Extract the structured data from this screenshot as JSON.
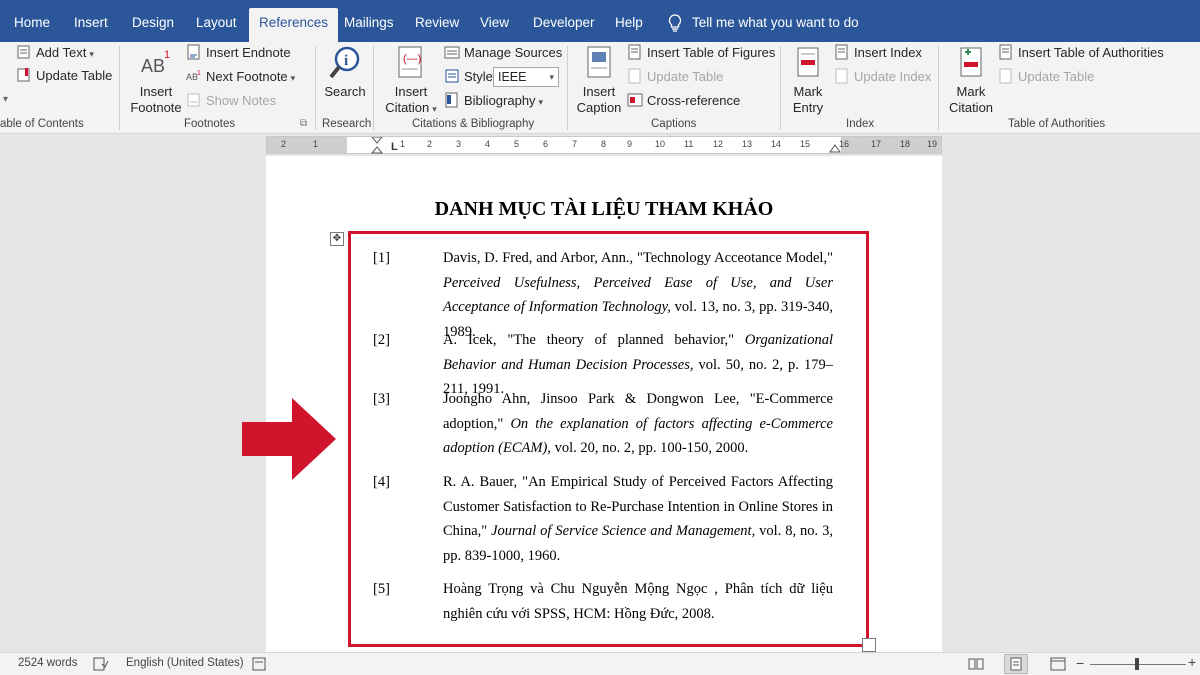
{
  "tabs": [
    {
      "label": "Home",
      "active": false
    },
    {
      "label": "Insert",
      "active": false
    },
    {
      "label": "Design",
      "active": false
    },
    {
      "label": "Layout",
      "active": false
    },
    {
      "label": "References",
      "active": true
    },
    {
      "label": "Mailings",
      "active": false
    },
    {
      "label": "Review",
      "active": false
    },
    {
      "label": "View",
      "active": false
    },
    {
      "label": "Developer",
      "active": false
    },
    {
      "label": "Help",
      "active": false
    }
  ],
  "tell_me": "Tell me what you want to do",
  "ribbon": {
    "toc": {
      "add_text": "Add Text",
      "update_table": "Update Table",
      "group": "able of Contents"
    },
    "footnotes": {
      "insert_footnote": "Insert Footnote",
      "insert_endnote": "Insert Endnote",
      "next_footnote": "Next Footnote",
      "show_notes": "Show Notes",
      "group": "Footnotes"
    },
    "research": {
      "search": "Search",
      "group": "Research"
    },
    "citations": {
      "insert_citation": "Insert Citation",
      "manage_sources": "Manage Sources",
      "style_label": "Style:",
      "style_value": "IEEE",
      "bibliography": "Bibliography",
      "group": "Citations & Bibliography"
    },
    "captions": {
      "insert_caption": "Insert Caption",
      "insert_table_of_figures": "Insert Table of Figures",
      "update_table": "Update Table",
      "cross_reference": "Cross-reference",
      "group": "Captions"
    },
    "index": {
      "mark_entry": "Mark Entry",
      "insert_index": "Insert Index",
      "update_index": "Update Index",
      "group": "Index"
    },
    "authorities": {
      "mark_citation": "Mark Citation",
      "insert_table": "Insert Table of Authorities",
      "update_table": "Update Table",
      "group": "Table of Authorities"
    }
  },
  "ruler_ticks": [
    "2",
    "1",
    "1",
    "2",
    "3",
    "4",
    "5",
    "6",
    "7",
    "8",
    "9",
    "10",
    "11",
    "12",
    "13",
    "14",
    "15",
    "16",
    "17",
    "18",
    "19"
  ],
  "document": {
    "title": "DANH MỤC TÀI LIỆU THAM KHẢO",
    "references": [
      {
        "num": "[1]",
        "before": "Davis, D. Fred, and Arbor, Ann., \"Technology Acceotance Model,\" ",
        "italic": "Perceived Usefulness, Perceived Ease of Use, and User Acceptance of Information Technology,",
        "after": " vol. 13, no. 3, pp. 319-340, 1989."
      },
      {
        "num": "[2]",
        "before": "A. Icek, \"The theory of planned behavior,\" ",
        "italic": "Organizational Behavior and Human Decision Processes,",
        "after": " vol. 50, no. 2, p. 179–211, 1991."
      },
      {
        "num": "[3]",
        "before": "Joongho Ahn, Jinsoo Park & Dongwon Lee, \"E-Commerce adoption,\" ",
        "italic": "On the explanation of factors affecting e-Commerce adoption (ECAM),",
        "after": " vol. 20, no. 2, pp. 100-150, 2000."
      },
      {
        "num": "[4]",
        "before": "R. A. Bauer, \"An Empirical Study of Perceived Factors Affecting Customer Satisfaction to Re-Purchase Intention in Online Stores in China,\" ",
        "italic": "Journal of Service Science and Management,",
        "after": " vol. 8, no. 3, pp. 839-1000, 1960."
      },
      {
        "num": "[5]",
        "before": "Hoàng Trọng và Chu Nguyễn Mộng Ngọc , Phân tích dữ liệu nghiên cứu với SPSS, HCM: Hồng Đức, 2008.",
        "italic": "",
        "after": ""
      }
    ]
  },
  "status": {
    "words": "2524 words",
    "language": "English (United States)"
  },
  "colors": {
    "accent": "#2b579a",
    "highlight_red": "#d0142c"
  }
}
